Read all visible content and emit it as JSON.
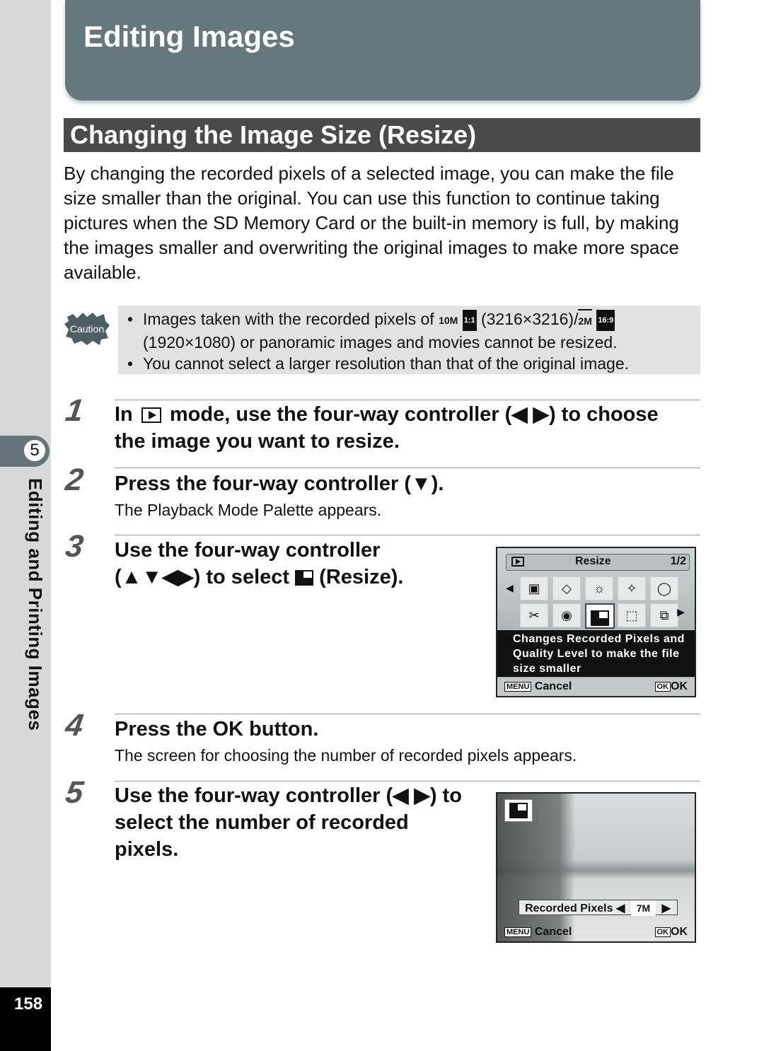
{
  "chapter": {
    "number": "5",
    "title": "Editing and Printing Images",
    "page_number": "158"
  },
  "header": {
    "title": "Editing Images"
  },
  "section": {
    "title": "Changing the Image Size (Resize)",
    "intro": "By changing the recorded pixels of a selected image, you can make the file size smaller than the original. You can use this function to continue taking pictures when the SD Memory Card or the built-in memory is full, by making the images smaller and overwriting the original images to make more space available."
  },
  "caution": {
    "icon_label": "Caution",
    "bullet": "•",
    "items": [
      {
        "text_before": "Images taken with the recorded pixels of ",
        "badge1": "10M",
        "badge1_aspect": "1:1",
        "text_mid": " (3216×3216)/",
        "badge2": "2M",
        "badge2_aspect": "16:9",
        "text_after": " (1920×1080) or panoramic images and movies cannot be resized."
      },
      {
        "text": "You cannot select a larger resolution than that of the original image."
      }
    ]
  },
  "steps": [
    {
      "number": "1",
      "heading_before": "In ",
      "heading_after": " mode, use the four-way controller (◀ ▶) to choose the image you want to resize."
    },
    {
      "number": "2",
      "heading": "Press the four-way controller (▼).",
      "sub": "The Playback Mode Palette appears."
    },
    {
      "number": "3",
      "heading_line1": "Use the four-way controller",
      "heading_line2_before": "(▲▼◀▶) to select ",
      "heading_line2_after": " (Resize)."
    },
    {
      "number": "4",
      "heading": "Press the OK  button.",
      "sub": "The screen for choosing the number of recorded pixels appears."
    },
    {
      "number": "5",
      "heading": "Use the four-way controller (◀ ▶) to select the number of recorded pixels."
    }
  ],
  "screen1": {
    "title": "Resize",
    "page": "1/2",
    "icons": [
      "▣",
      "◇",
      "☼",
      "✧",
      "◯",
      "✂",
      "◉",
      "",
      "⬚",
      "⧉"
    ],
    "selected_index": 7,
    "description": "Changes Recorded Pixels and Quality Level to make the file size smaller",
    "menu_key": "MENU",
    "cancel": "Cancel",
    "ok_key": "OK",
    "ok": "OK"
  },
  "screen2": {
    "label": "Recorded Pixels",
    "value": "7M",
    "menu_key": "MENU",
    "cancel": "Cancel",
    "ok_key": "OK",
    "ok": "OK"
  }
}
